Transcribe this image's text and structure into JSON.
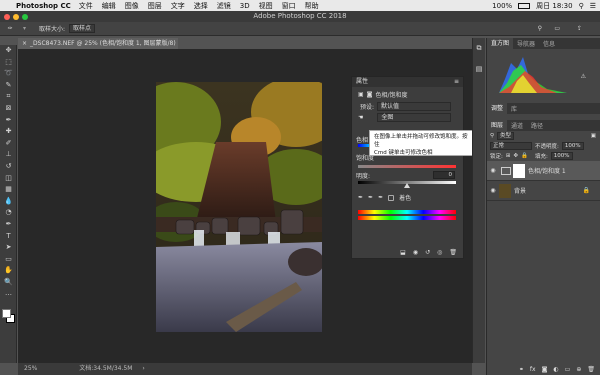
{
  "menubar": {
    "apple": "",
    "app": "Photoshop CC",
    "items": [
      "文件",
      "编辑",
      "图像",
      "图层",
      "文字",
      "选择",
      "滤镜",
      "3D",
      "视图",
      "窗口",
      "帮助"
    ],
    "battery": "100%",
    "clock": "周日 18:30"
  },
  "window": {
    "title": "Adobe Photoshop CC 2018"
  },
  "options": {
    "sample_label": "取样大小:",
    "sample_value": "取样点"
  },
  "document": {
    "tab": "_DSC8473.NEF @ 25% (色相/饱和度 1, 图层蒙版/8) *"
  },
  "status": {
    "zoom": "25%",
    "doc": "文档:34.5M/34.5M"
  },
  "properties": {
    "title": "属性",
    "subtitle": "色相/饱和度",
    "preset_label": "预设:",
    "preset_value": "默认值",
    "channel_value": "全图",
    "hue_label": "色相",
    "hue_value": "0",
    "sat_label": "饱和度",
    "lightness_label": "明度:",
    "lightness_value": "0",
    "colorize_label": "着色"
  },
  "tooltip": {
    "line1": "在图像上单击并拖动可修改饱和度。按住",
    "line2": "Cmd 键单击可修改色相"
  },
  "histogram": {
    "tabs": [
      "直方图",
      "导航器",
      "信息"
    ],
    "colors": {
      "red": "#ff3030",
      "green": "#30e030",
      "blue": "#3070ff",
      "yellow": "#e8e830",
      "cyan": "#30e0e0"
    }
  },
  "adjust": {
    "tabs": [
      "调整",
      "库"
    ]
  },
  "layers": {
    "tabs": [
      "图层",
      "通道",
      "路径"
    ],
    "kind": "类型",
    "blend": "正常",
    "opacity_label": "不透明度:",
    "opacity_value": "100%",
    "lock_label": "锁定:",
    "fill_label": "填充:",
    "fill_value": "100%",
    "rows": [
      {
        "name": "色相/饱和度 1"
      },
      {
        "name": "背景"
      }
    ]
  }
}
